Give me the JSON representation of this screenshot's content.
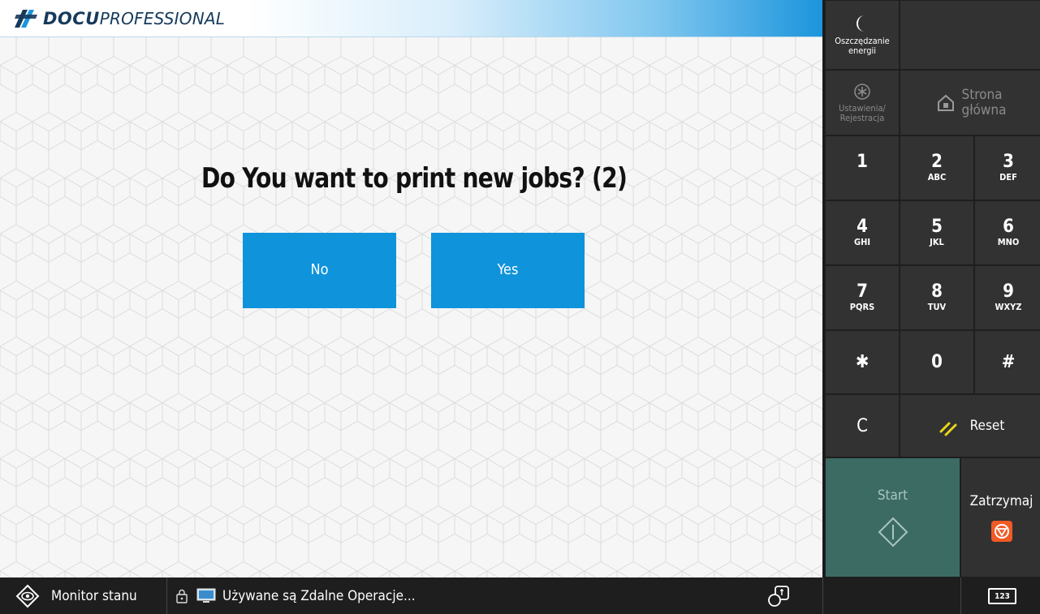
{
  "header": {
    "brand_bold": "DOCU",
    "brand_light": "PROFESSIONAL"
  },
  "dialog": {
    "question": "Do You want to print new jobs? (2)",
    "no_label": "No",
    "yes_label": "Yes",
    "button_color": "#0f93db"
  },
  "panel": {
    "energy_save_label_1": "Oszczędzanie",
    "energy_save_label_2": "energii",
    "settings_label_1": "Ustawienia/",
    "settings_label_2": "Rejestracja",
    "home_label_1": "Strona",
    "home_label_2": "główna",
    "keys": [
      {
        "digit": "1",
        "letters": ""
      },
      {
        "digit": "2",
        "letters": "ABC"
      },
      {
        "digit": "3",
        "letters": "DEF"
      },
      {
        "digit": "4",
        "letters": "GHI"
      },
      {
        "digit": "5",
        "letters": "JKL"
      },
      {
        "digit": "6",
        "letters": "MNO"
      },
      {
        "digit": "7",
        "letters": "PQRS"
      },
      {
        "digit": "8",
        "letters": "TUV"
      },
      {
        "digit": "9",
        "letters": "WXYZ"
      },
      {
        "digit": "✱",
        "letters": ""
      },
      {
        "digit": "0",
        "letters": ""
      },
      {
        "digit": "#",
        "letters": ""
      }
    ],
    "clear_label": "C",
    "reset_label": "Reset",
    "start_label": "Start",
    "stop_label": "Zatrzymaj",
    "start_color": "#3c6b64",
    "stop_icon_color": "#f15a24"
  },
  "statusbar": {
    "monitor_label": "Monitor stanu",
    "message": "Używane są Zdalne Operacje...",
    "keypad_label": "123"
  }
}
